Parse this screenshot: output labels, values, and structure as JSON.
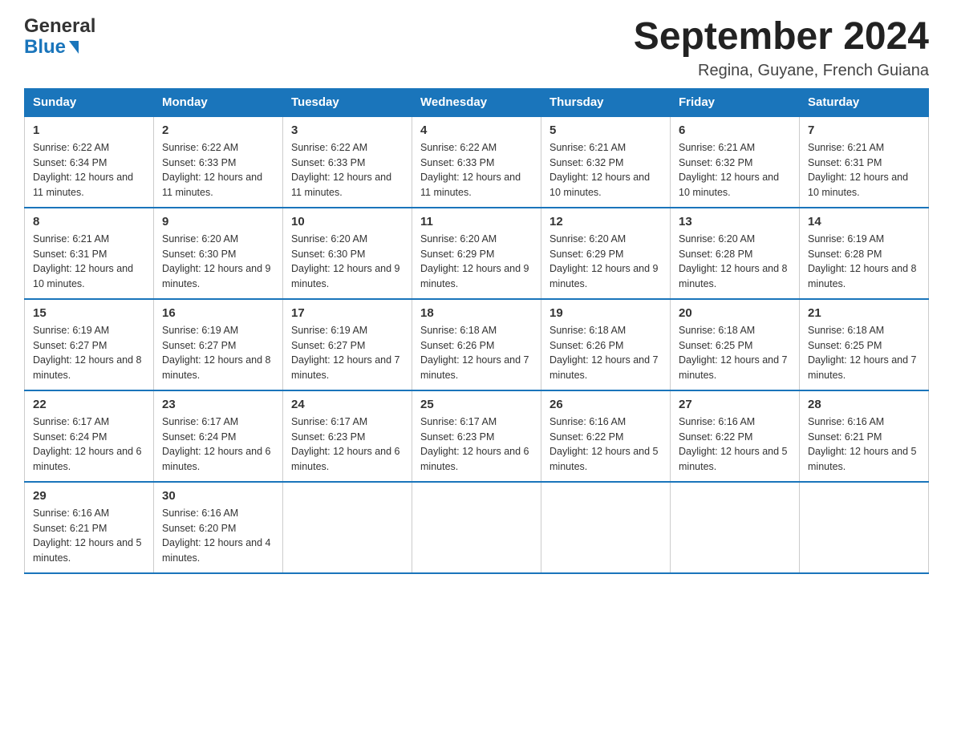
{
  "header": {
    "logo_general": "General",
    "logo_blue": "Blue",
    "month_title": "September 2024",
    "location": "Regina, Guyane, French Guiana"
  },
  "weekdays": [
    "Sunday",
    "Monday",
    "Tuesday",
    "Wednesday",
    "Thursday",
    "Friday",
    "Saturday"
  ],
  "weeks": [
    [
      {
        "day": "1",
        "sunrise": "6:22 AM",
        "sunset": "6:34 PM",
        "daylight": "12 hours and 11 minutes."
      },
      {
        "day": "2",
        "sunrise": "6:22 AM",
        "sunset": "6:33 PM",
        "daylight": "12 hours and 11 minutes."
      },
      {
        "day": "3",
        "sunrise": "6:22 AM",
        "sunset": "6:33 PM",
        "daylight": "12 hours and 11 minutes."
      },
      {
        "day": "4",
        "sunrise": "6:22 AM",
        "sunset": "6:33 PM",
        "daylight": "12 hours and 11 minutes."
      },
      {
        "day": "5",
        "sunrise": "6:21 AM",
        "sunset": "6:32 PM",
        "daylight": "12 hours and 10 minutes."
      },
      {
        "day": "6",
        "sunrise": "6:21 AM",
        "sunset": "6:32 PM",
        "daylight": "12 hours and 10 minutes."
      },
      {
        "day": "7",
        "sunrise": "6:21 AM",
        "sunset": "6:31 PM",
        "daylight": "12 hours and 10 minutes."
      }
    ],
    [
      {
        "day": "8",
        "sunrise": "6:21 AM",
        "sunset": "6:31 PM",
        "daylight": "12 hours and 10 minutes."
      },
      {
        "day": "9",
        "sunrise": "6:20 AM",
        "sunset": "6:30 PM",
        "daylight": "12 hours and 9 minutes."
      },
      {
        "day": "10",
        "sunrise": "6:20 AM",
        "sunset": "6:30 PM",
        "daylight": "12 hours and 9 minutes."
      },
      {
        "day": "11",
        "sunrise": "6:20 AM",
        "sunset": "6:29 PM",
        "daylight": "12 hours and 9 minutes."
      },
      {
        "day": "12",
        "sunrise": "6:20 AM",
        "sunset": "6:29 PM",
        "daylight": "12 hours and 9 minutes."
      },
      {
        "day": "13",
        "sunrise": "6:20 AM",
        "sunset": "6:28 PM",
        "daylight": "12 hours and 8 minutes."
      },
      {
        "day": "14",
        "sunrise": "6:19 AM",
        "sunset": "6:28 PM",
        "daylight": "12 hours and 8 minutes."
      }
    ],
    [
      {
        "day": "15",
        "sunrise": "6:19 AM",
        "sunset": "6:27 PM",
        "daylight": "12 hours and 8 minutes."
      },
      {
        "day": "16",
        "sunrise": "6:19 AM",
        "sunset": "6:27 PM",
        "daylight": "12 hours and 8 minutes."
      },
      {
        "day": "17",
        "sunrise": "6:19 AM",
        "sunset": "6:27 PM",
        "daylight": "12 hours and 7 minutes."
      },
      {
        "day": "18",
        "sunrise": "6:18 AM",
        "sunset": "6:26 PM",
        "daylight": "12 hours and 7 minutes."
      },
      {
        "day": "19",
        "sunrise": "6:18 AM",
        "sunset": "6:26 PM",
        "daylight": "12 hours and 7 minutes."
      },
      {
        "day": "20",
        "sunrise": "6:18 AM",
        "sunset": "6:25 PM",
        "daylight": "12 hours and 7 minutes."
      },
      {
        "day": "21",
        "sunrise": "6:18 AM",
        "sunset": "6:25 PM",
        "daylight": "12 hours and 7 minutes."
      }
    ],
    [
      {
        "day": "22",
        "sunrise": "6:17 AM",
        "sunset": "6:24 PM",
        "daylight": "12 hours and 6 minutes."
      },
      {
        "day": "23",
        "sunrise": "6:17 AM",
        "sunset": "6:24 PM",
        "daylight": "12 hours and 6 minutes."
      },
      {
        "day": "24",
        "sunrise": "6:17 AM",
        "sunset": "6:23 PM",
        "daylight": "12 hours and 6 minutes."
      },
      {
        "day": "25",
        "sunrise": "6:17 AM",
        "sunset": "6:23 PM",
        "daylight": "12 hours and 6 minutes."
      },
      {
        "day": "26",
        "sunrise": "6:16 AM",
        "sunset": "6:22 PM",
        "daylight": "12 hours and 5 minutes."
      },
      {
        "day": "27",
        "sunrise": "6:16 AM",
        "sunset": "6:22 PM",
        "daylight": "12 hours and 5 minutes."
      },
      {
        "day": "28",
        "sunrise": "6:16 AM",
        "sunset": "6:21 PM",
        "daylight": "12 hours and 5 minutes."
      }
    ],
    [
      {
        "day": "29",
        "sunrise": "6:16 AM",
        "sunset": "6:21 PM",
        "daylight": "12 hours and 5 minutes."
      },
      {
        "day": "30",
        "sunrise": "6:16 AM",
        "sunset": "6:20 PM",
        "daylight": "12 hours and 4 minutes."
      },
      null,
      null,
      null,
      null,
      null
    ]
  ]
}
